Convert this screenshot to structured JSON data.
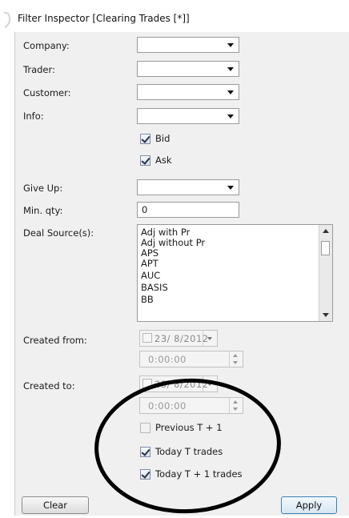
{
  "window": {
    "title": "Filter Inspector [Clearing Trades [*]]"
  },
  "fields": {
    "company_label": "Company:",
    "trader_label": "Trader:",
    "customer_label": "Customer:",
    "info_label": "Info:",
    "bid": {
      "label": "Bid",
      "checked": true
    },
    "ask": {
      "label": "Ask",
      "checked": true
    },
    "give_up_label": "Give Up:",
    "min_qty_label": "Min. qty:",
    "min_qty_value": "0",
    "deal_source_label": "Deal Source(s):",
    "deal_sources": [
      "Adj with Pr",
      "Adj without Pr",
      "APS",
      "APT",
      "AUC",
      "BASIS",
      "BB"
    ]
  },
  "created": {
    "from_label": "Created from:",
    "from_date": "23/ 8/2012",
    "from_time": "0:00:00",
    "to_label": "Created to:",
    "to_date": "23/ 8/2012",
    "to_time": "0:00:00"
  },
  "options": {
    "previous": {
      "label": "Previous T + 1",
      "checked": false
    },
    "today": {
      "label": "Today T trades",
      "checked": true
    },
    "today_plus": {
      "label": "Today T + 1 trades",
      "checked": true
    }
  },
  "buttons": {
    "clear": "Clear",
    "apply": "Apply"
  },
  "colors": {
    "panel": "#f0f0f0",
    "annotation": "#000000",
    "primary_border": "#3c7fb1"
  }
}
